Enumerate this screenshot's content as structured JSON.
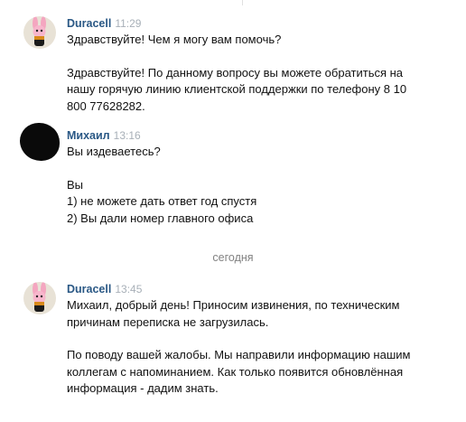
{
  "messages": [
    {
      "author": "Duracell",
      "time": "11:29",
      "avatar_icon": "pink-bunny-avatar",
      "paragraphs": [
        [
          "Здравствуйте! Чем я могу вам помочь?"
        ],
        [
          "Здравствуйте! По данному вопросу вы можете обратиться на",
          "нашу горячую линию клиентской поддержки по телефону 8 10",
          "800 77628282."
        ]
      ]
    },
    {
      "author": "Михаил",
      "time": "13:16",
      "avatar_icon": "redacted-avatar",
      "paragraphs": [
        [
          "Вы издеваетесь?"
        ],
        [
          "Вы",
          "1) не можете дать ответ год спустя",
          "2) Вы дали номер главного офиса"
        ]
      ]
    },
    {
      "author": "Duracell",
      "time": "13:45",
      "avatar_icon": "pink-bunny-avatar",
      "paragraphs": [
        [
          "Михаил, добрый день! Приносим извинения, по техническим",
          "причинам переписка не загрузилась."
        ],
        [
          "По поводу вашей жалобы. Мы направили информацию нашим",
          "коллегам с напоминанием. Как только появится обновлённая",
          "информация - дадим знать."
        ]
      ]
    }
  ],
  "date_separator": "сегодня",
  "colors": {
    "author": "#2a5885",
    "time": "#a8b0b8",
    "text": "#111111",
    "separator": "#828282"
  }
}
